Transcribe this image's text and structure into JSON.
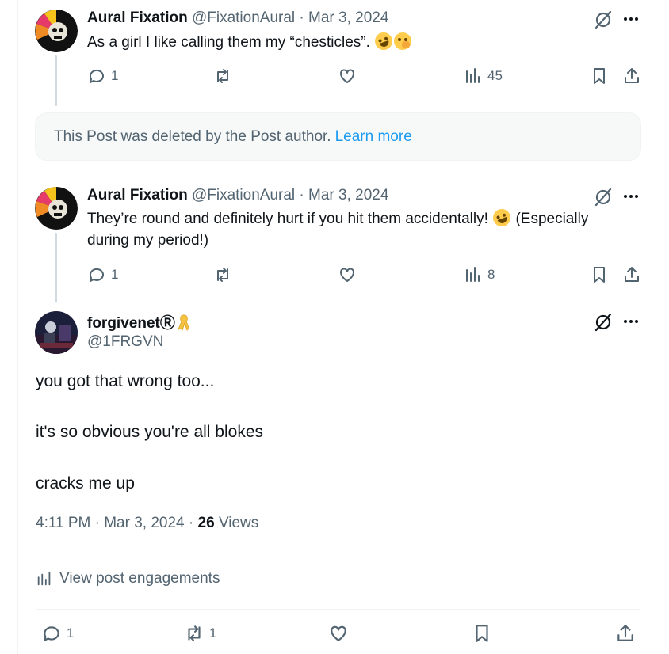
{
  "reply1": {
    "name": "Aural Fixation",
    "handle": "@FixationAural",
    "date": "· Mar 3, 2024",
    "text": "As a girl I like calling them my “chesticles”.",
    "replies": "1",
    "views": "45"
  },
  "deleted": {
    "text": "This Post was deleted by the Post author.",
    "link": "Learn more"
  },
  "reply2": {
    "name": "Aural Fixation",
    "handle": "@FixationAural",
    "date": "· Mar 3, 2024",
    "text_line1": "They’re round and definitely hurt if you hit them accidentally!",
    "text_line1_end": "(Especially",
    "text_line2": "during my period!)",
    "replies": "1",
    "views": "8"
  },
  "main": {
    "name": "forgivenetⓇ",
    "handle": "@1FRGVN",
    "line1": "you got that wrong too...",
    "line2": "it's so obvious you're all blokes",
    "line3": "cracks me up",
    "time": "4:11 PM · Mar 3, 2024 ·",
    "views_count": "26",
    "views_label": "Views",
    "engagements": "View post engagements",
    "replies": "1",
    "reposts": "1"
  },
  "icons": [
    "reply-icon",
    "repost-icon",
    "like-icon",
    "views-icon",
    "bookmark-icon",
    "share-icon",
    "grok-icon",
    "more-icon"
  ],
  "colors": {
    "accent": "#1d9bf0",
    "secondary_text": "#536471",
    "primary_text": "#0f1419"
  }
}
